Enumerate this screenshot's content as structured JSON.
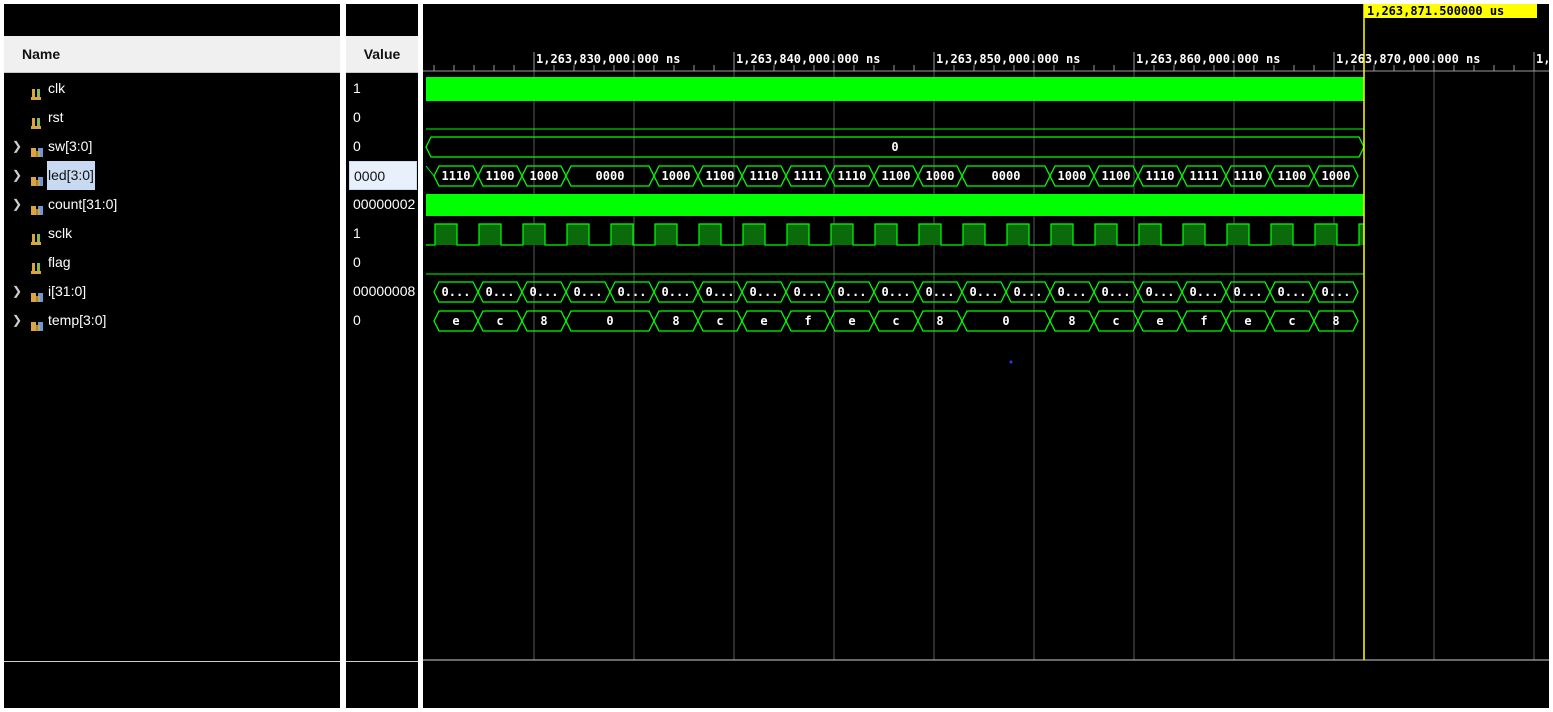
{
  "headers": {
    "name": "Name",
    "value": "Value"
  },
  "cursor": {
    "label": "1,263,871.500000 us"
  },
  "ruler": {
    "labels": [
      "1,263,830,000.000 ns",
      "1,263,840,000.000 ns",
      "1,263,850,000.000 ns",
      "1,263,860,000.000 ns",
      "1,263,870,000.000 ns",
      "1,"
    ]
  },
  "signals": [
    {
      "name": "clk",
      "value": "1",
      "expandable": false,
      "icon": "scalar-signal-icon"
    },
    {
      "name": "rst",
      "value": "0",
      "expandable": false,
      "icon": "scalar-signal-icon"
    },
    {
      "name": "sw[3:0]",
      "value": "0",
      "expandable": true,
      "icon": "bus-signal-icon"
    },
    {
      "name": "led[3:0]",
      "value": "0000",
      "expandable": true,
      "icon": "bus-signal-icon",
      "selected": true
    },
    {
      "name": "count[31:0]",
      "value": "00000002",
      "expandable": true,
      "icon": "bus-signal-icon"
    },
    {
      "name": "sclk",
      "value": "1",
      "expandable": false,
      "icon": "scalar-signal-icon"
    },
    {
      "name": "flag",
      "value": "0",
      "expandable": false,
      "icon": "scalar-signal-icon"
    },
    {
      "name": "i[31:0]",
      "value": "00000008",
      "expandable": true,
      "icon": "bus-signal-icon"
    },
    {
      "name": "temp[3:0]",
      "value": "0",
      "expandable": true,
      "icon": "bus-signal-icon"
    }
  ],
  "bus_values": {
    "sw": [
      "0"
    ],
    "led": [
      "1110",
      "1100",
      "1000",
      "0000",
      "1000",
      "1100",
      "1110",
      "1111",
      "1110",
      "1100",
      "1000",
      "0000",
      "1000",
      "1100",
      "1110",
      "1111",
      "1110",
      "1100",
      "1000"
    ],
    "i": [
      "0...",
      "0...",
      "0...",
      "0...",
      "0...",
      "0...",
      "0...",
      "0...",
      "0...",
      "0...",
      "0...",
      "0...",
      "0...",
      "0...",
      "0...",
      "0...",
      "0...",
      "0...",
      "0...",
      "0...",
      "0..."
    ],
    "temp": [
      "e",
      "c",
      "8",
      "0",
      "8",
      "c",
      "e",
      "f",
      "e",
      "c",
      "8",
      "0",
      "8",
      "c",
      "e",
      "f",
      "e",
      "c",
      "8"
    ]
  },
  "colors": {
    "wave": "#00ff00",
    "wave_dim": "#0b6b0b",
    "cursor": "#ffff00",
    "background": "#000000"
  }
}
